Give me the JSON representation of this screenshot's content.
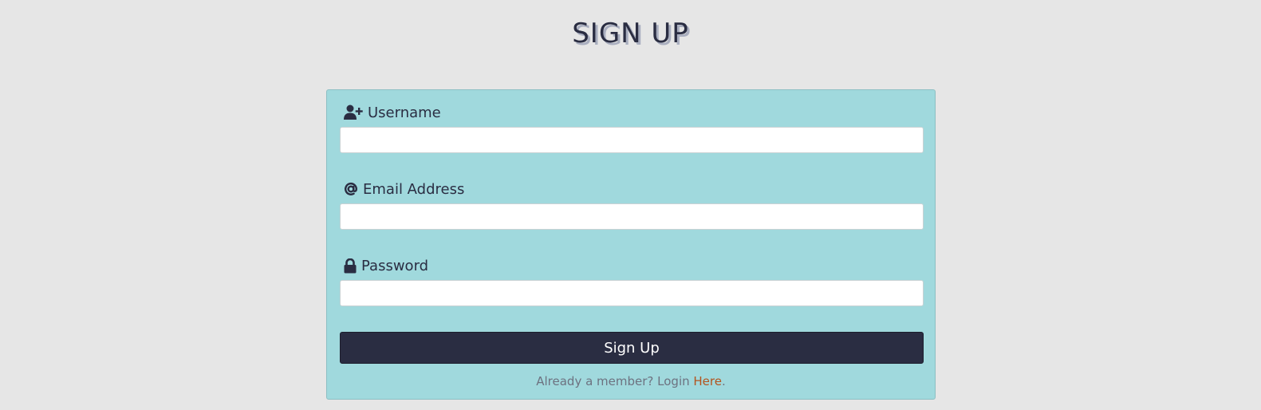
{
  "title": "SIGN UP",
  "form": {
    "username": {
      "label": "Username",
      "icon": "user-plus-icon",
      "value": "",
      "placeholder": ""
    },
    "email": {
      "label": "Email Address",
      "icon": "at-sign-icon",
      "value": "",
      "placeholder": ""
    },
    "password": {
      "label": "Password",
      "icon": "lock-icon",
      "value": "",
      "placeholder": ""
    },
    "submit_label": "Sign Up"
  },
  "footer": {
    "prefix": "Already a member? Login ",
    "link_text": "Here",
    "suffix": "."
  },
  "colors": {
    "background": "#e6e6e6",
    "card": "#a0d9dd",
    "primary": "#2a2d42",
    "link": "#b3541e"
  }
}
